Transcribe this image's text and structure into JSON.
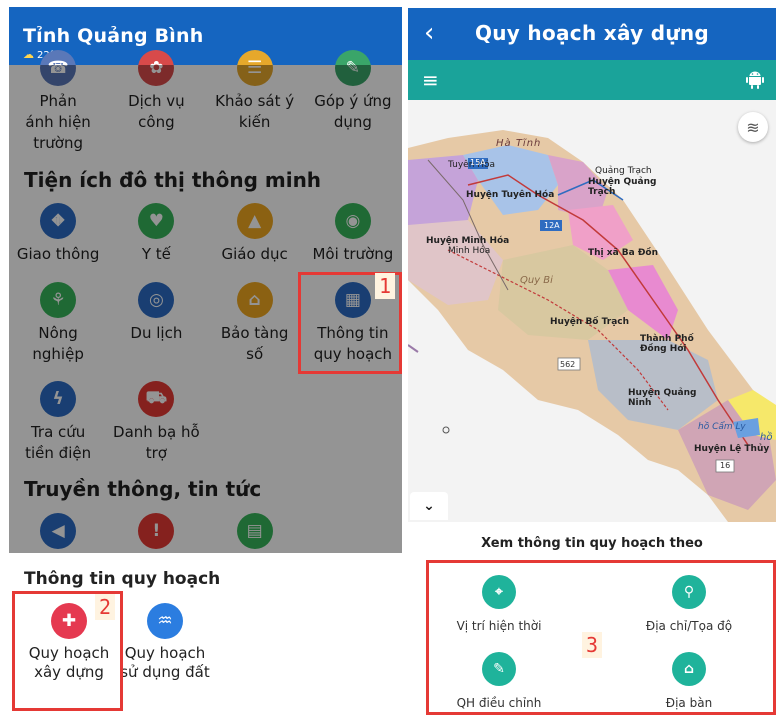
{
  "left": {
    "header": {
      "title": "Tỉnh Quảng Bình",
      "weather": "22°C"
    },
    "row0": [
      {
        "label": "Phản ánh hiện trường",
        "icon": "report-icon",
        "color": "#5a78b8"
      },
      {
        "label": "Dịch vụ công",
        "icon": "service-icon",
        "color": "#d84a4a"
      },
      {
        "label": "Khảo sát ý kiến",
        "icon": "survey-icon",
        "color": "#e6a82b"
      },
      {
        "label": "Góp ý ứng dụng",
        "icon": "feedback-icon",
        "color": "#3aa569"
      }
    ],
    "section1": "Tiện ích đô thị thông minh",
    "row1": [
      {
        "label": "Giao thông",
        "icon": "traffic-icon",
        "color": "#2b6cc4"
      },
      {
        "label": "Y tế",
        "icon": "health-icon",
        "color": "#36b55a"
      },
      {
        "label": "Giáo dục",
        "icon": "education-icon",
        "color": "#f0a820"
      },
      {
        "label": "Môi trường",
        "icon": "environment-icon",
        "color": "#36b55a"
      }
    ],
    "row2": [
      {
        "label": "Nông nghiệp",
        "icon": "agriculture-icon",
        "color": "#36b55a"
      },
      {
        "label": "Du lịch",
        "icon": "tourism-icon",
        "color": "#2b6cc4"
      },
      {
        "label": "Bảo tàng số",
        "icon": "museum-icon",
        "color": "#f0a820"
      },
      {
        "label": "Thông tin quy hoạch",
        "icon": "planning-map-icon",
        "color": "#2b6cc4"
      }
    ],
    "row3": [
      {
        "label": "Tra cứu tiền điện",
        "icon": "electricity-icon",
        "color": "#2b6cc4"
      },
      {
        "label": "Danh bạ hỗ trợ",
        "icon": "contacts-icon",
        "color": "#e53935"
      }
    ],
    "section2": "Truyền thông, tin tức",
    "row4": [
      {
        "icon": "megaphone-icon",
        "color": "#2b6cc4"
      },
      {
        "icon": "alert-news-icon",
        "color": "#e53935"
      },
      {
        "icon": "news-icon",
        "color": "#36b55a"
      }
    ],
    "sheet": {
      "title": "Thông tin quy hoạch",
      "items": [
        {
          "label": "Quy hoạch xây dựng",
          "icon": "construction-planning-icon",
          "color": "#e53950"
        },
        {
          "label": "Quy hoạch sử dụng đất",
          "icon": "land-use-icon",
          "color": "#2b7de0"
        }
      ]
    },
    "badges": [
      "1",
      "2"
    ]
  },
  "right": {
    "header": {
      "back": "‹",
      "title": "Quy hoạch xây dựng"
    },
    "toolbar": {
      "menu": "≡",
      "apple": ""
    },
    "map": {
      "labels": [
        "Hà Tĩnh",
        "Tuyên Hóa",
        "15A",
        "Huyện Tuyên Hóa",
        "Quảng Trạch",
        "Huyện Quảng Trạch",
        "12A",
        "Huyện Minh Hóa",
        "Minh Hóa",
        "Thị xã Ba Đồn",
        "Quy Bi",
        "Huyện Bố Trạch",
        "Thành Phố Đồng Hới",
        "562",
        "Huyện Quảng Ninh",
        "Huyện Lệ Thủy",
        "16",
        "hồ Cẩm Ly",
        "hồ"
      ]
    },
    "info": {
      "title": "Xem thông tin quy hoạch theo",
      "options": [
        {
          "label": "Vị trí hiện thời",
          "icon": "crosshair-icon"
        },
        {
          "label": "Địa chỉ/Tọa độ",
          "icon": "map-pin-icon"
        },
        {
          "label": "QH điều chỉnh",
          "icon": "edit-icon"
        },
        {
          "label": "Địa bàn",
          "icon": "bank-building-icon"
        }
      ]
    },
    "badge": "3"
  }
}
